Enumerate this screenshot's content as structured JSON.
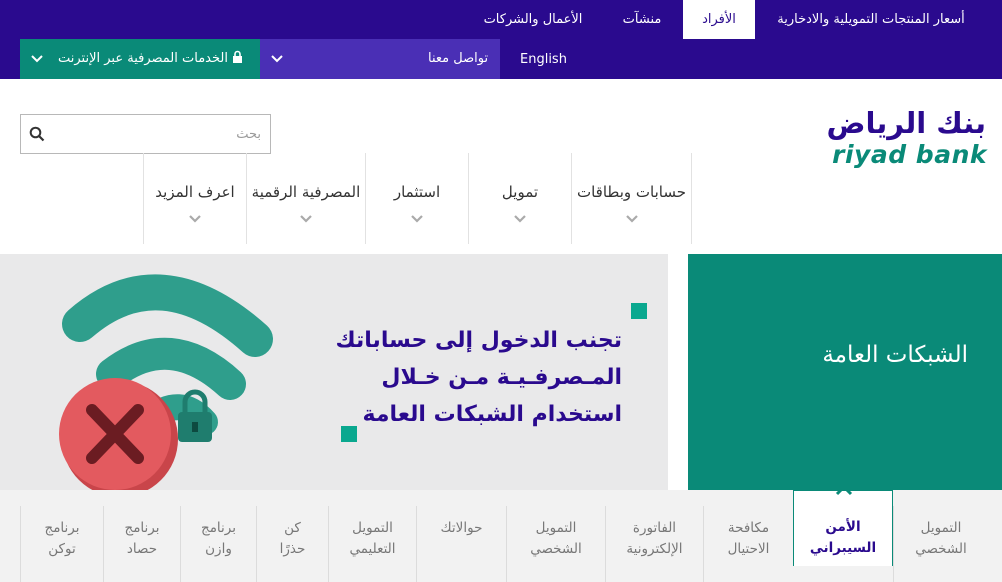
{
  "topbar": {
    "tabs": [
      "أسعار المنتجات التمويلية والادخارية",
      "الأفراد",
      "منشآت",
      "الأعمال والشركات"
    ],
    "english": "English",
    "contact": "تواصل معنا",
    "online_banking": "الخدمات المصرفية عبر الإنترنت"
  },
  "header": {
    "logo_ar": "بنك الرياض",
    "logo_en": "riyad bank",
    "search_placeholder": "بحث",
    "nav": [
      "حسابات وبطاقات",
      "تمويل",
      "استثمار",
      "المصرفية الرقمية",
      "اعرف المزيد"
    ]
  },
  "hero": {
    "line1": "تجنب الدخول إلى حساباتك",
    "line2": "المـصرفـيـة مـن خـلال",
    "line3": "استخدام الشبكات العامة",
    "panel_title": "الشبكات العامة"
  },
  "bottom_tabs": [
    {
      "l1": "التمويل",
      "l2": "الشخصي"
    },
    {
      "l1": "الأمن",
      "l2": "السيبراني"
    },
    {
      "l1": "مكافحة",
      "l2": "الاحتيال"
    },
    {
      "l1": "الفاتورة",
      "l2": "الإلكترونية"
    },
    {
      "l1": "التمويل",
      "l2": "الشخصي"
    },
    {
      "l1": "حوالاتك",
      "l2": ""
    },
    {
      "l1": "التمويل",
      "l2": "التعليمي"
    },
    {
      "l1": "كن",
      "l2": "حذرًا"
    },
    {
      "l1": "برنامج",
      "l2": "وازن"
    },
    {
      "l1": "برنامج",
      "l2": "حصاد"
    },
    {
      "l1": "برنامج",
      "l2": "توكن"
    }
  ],
  "colors": {
    "brand_purple": "#2a0a8e",
    "brand_teal": "#0a8a78",
    "alert_red": "#d9534f"
  }
}
